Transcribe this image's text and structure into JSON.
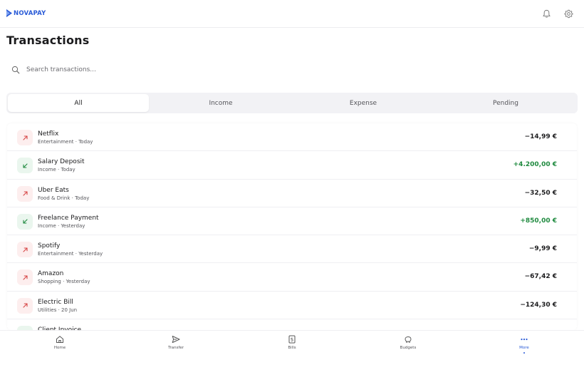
{
  "brand": {
    "name": "NOVAPAY",
    "color": "#2a5bd7"
  },
  "header": {
    "icons": [
      "bell-icon",
      "gear-icon"
    ]
  },
  "page": {
    "title": "Transactions"
  },
  "search": {
    "placeholder": "Search transactions..."
  },
  "tabs": [
    {
      "label": "All",
      "active": true
    },
    {
      "label": "Income",
      "active": false
    },
    {
      "label": "Expense",
      "active": false
    },
    {
      "label": "Pending",
      "active": false
    }
  ],
  "transactions": [
    {
      "name": "Netflix",
      "category": "Entertainment",
      "date": "Today",
      "amount": "−14,99 €",
      "direction": "out"
    },
    {
      "name": "Salary Deposit",
      "category": "Income",
      "date": "Today",
      "amount": "+4.200,00 €",
      "direction": "in"
    },
    {
      "name": "Uber Eats",
      "category": "Food & Drink",
      "date": "Today",
      "amount": "−32,50 €",
      "direction": "out"
    },
    {
      "name": "Freelance Payment",
      "category": "Income",
      "date": "Yesterday",
      "amount": "+850,00 €",
      "direction": "in"
    },
    {
      "name": "Spotify",
      "category": "Entertainment",
      "date": "Yesterday",
      "amount": "−9,99 €",
      "direction": "out"
    },
    {
      "name": "Amazon",
      "category": "Shopping",
      "date": "Yesterday",
      "amount": "−67,42 €",
      "direction": "out"
    },
    {
      "name": "Electric Bill",
      "category": "Utilities",
      "date": "20 Jun",
      "amount": "−124,30 €",
      "direction": "out"
    },
    {
      "name": "Client Invoice",
      "category": "",
      "date": "",
      "amount": "",
      "direction": "in"
    }
  ],
  "colors": {
    "expense": "#d64545",
    "income": "#1f8a3f",
    "accent": "#2a5bd7"
  },
  "nav": [
    {
      "label": "Home",
      "icon": "home-icon",
      "active": false
    },
    {
      "label": "Transfer",
      "icon": "send-icon",
      "active": false
    },
    {
      "label": "Bills",
      "icon": "receipt-icon",
      "active": false
    },
    {
      "label": "Budgets",
      "icon": "piggy-bank-icon",
      "active": false
    },
    {
      "label": "More",
      "icon": "more-icon",
      "active": true
    }
  ]
}
